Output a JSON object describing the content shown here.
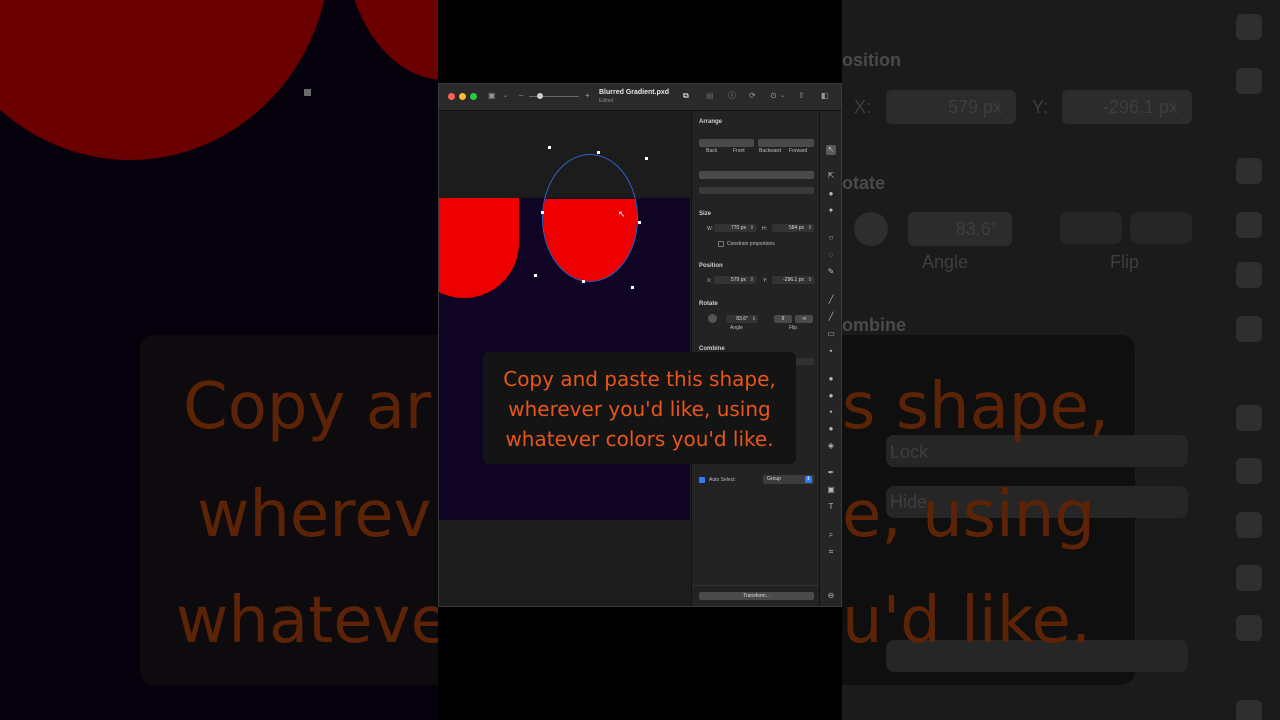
{
  "window": {
    "doc_title": "Blurred Gradient.pxd",
    "doc_status": "Edited"
  },
  "inspector": {
    "arrange_title": "Arrange",
    "arrange_buttons": [
      "Back",
      "Front",
      "Backward",
      "Forward"
    ],
    "size_title": "Size",
    "width_label": "W:",
    "width_value": "770 px",
    "height_label": "H:",
    "height_value": "584 px",
    "constrain_label": "Constrain proportions",
    "position_title": "Position",
    "x_label": "X:",
    "x_value": "579 px",
    "y_label": "Y:",
    "y_value": "-296.1 px",
    "rotate_title": "Rotate",
    "angle_value": "83.6°",
    "angle_label": "Angle",
    "flip_label": "Flip",
    "combine_title": "Combine",
    "auto_select_label": "Auto Select:",
    "auto_select_value": "Group",
    "transform_button": "Transform..."
  },
  "caption": {
    "line1": "Copy and paste this shape,",
    "line2": "wherever you'd like, using",
    "line3": "whatever colors you'd like."
  },
  "background_left": {
    "line1": "Copy ar",
    "line2": "wherev",
    "line3": "whateve"
  },
  "background_right": {
    "position_title": "osition",
    "x_label": "X:",
    "x_value": "579 px",
    "y_label": "Y:",
    "y_value": "-296.1 px",
    "rotate_title": "otate",
    "angle_value": "83.6°",
    "angle_label": "Angle",
    "flip_label": "Flip",
    "combine_title": "ombine",
    "ghost_lock": "Lock",
    "ghost_hide": "Hide",
    "line1": "s shape,",
    "line2": "e, using",
    "line3": "u'd like."
  },
  "colors": {
    "shape_red": "#ef0000",
    "canvas_dark": "#0f0424",
    "selection_blue": "#2c63c7",
    "caption_orange": "#e8561a",
    "checkbox_blue": "#2f7df6"
  }
}
